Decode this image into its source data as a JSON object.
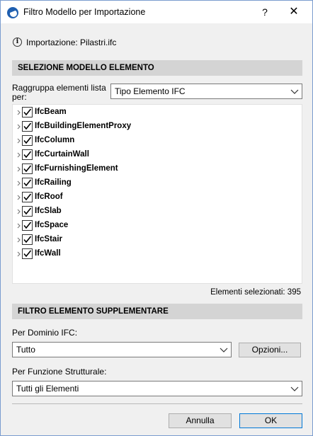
{
  "window": {
    "title": "Filtro Modello per Importazione",
    "help_label": "?",
    "close_label": "✕"
  },
  "info": {
    "text": "Importazione: Pilastri.ifc"
  },
  "section_model": {
    "title": "SELEZIONE MODELLO ELEMENTO",
    "group_label": "Raggruppa elementi lista per:",
    "group_value": "Tipo Elemento IFC"
  },
  "tree": {
    "items": [
      {
        "label": "IfcBeam",
        "checked": true
      },
      {
        "label": "IfcBuildingElementProxy",
        "checked": true
      },
      {
        "label": "IfcColumn",
        "checked": true
      },
      {
        "label": "IfcCurtainWall",
        "checked": true
      },
      {
        "label": "IfcFurnishingElement",
        "checked": true
      },
      {
        "label": "IfcRailing",
        "checked": true
      },
      {
        "label": "IfcRoof",
        "checked": true
      },
      {
        "label": "IfcSlab",
        "checked": true
      },
      {
        "label": "IfcSpace",
        "checked": true
      },
      {
        "label": "IfcStair",
        "checked": true
      },
      {
        "label": "IfcWall",
        "checked": true
      }
    ]
  },
  "selected_count_text": "Elementi selezionati: 395",
  "section_filter": {
    "title": "FILTRO ELEMENTO SUPPLEMENTARE",
    "domain_label": "Per Dominio IFC:",
    "domain_value": "Tutto",
    "options_button": "Opzioni...",
    "function_label": "Per Funzione Strutturale:",
    "function_value": "Tutti gli Elementi"
  },
  "footer": {
    "cancel_label": "Annulla",
    "ok_label": "OK"
  }
}
